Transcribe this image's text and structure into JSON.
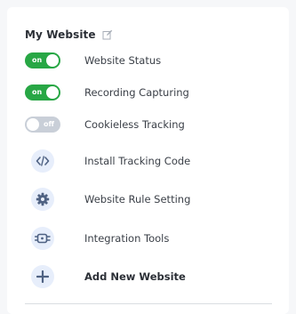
{
  "website": {
    "title": "My Website",
    "edit_icon": "edit-icon"
  },
  "toggles": [
    {
      "label": "Website Status",
      "state": "on",
      "state_label": "on"
    },
    {
      "label": "Recording Capturing",
      "state": "on",
      "state_label": "on"
    },
    {
      "label": "Cookieless Tracking",
      "state": "off",
      "state_label": "off"
    }
  ],
  "actions": [
    {
      "label": "Install Tracking Code",
      "icon": "code-icon"
    },
    {
      "label": "Website Rule Setting",
      "icon": "gear-icon"
    },
    {
      "label": "Integration Tools",
      "icon": "integration-icon"
    },
    {
      "label": "Add New Website",
      "icon": "plus-icon"
    }
  ],
  "colors": {
    "toggle_on": "#28a745",
    "toggle_off": "#c9cfd8",
    "icon_bg": "#e7eefb",
    "icon_fg": "#4f6283"
  }
}
